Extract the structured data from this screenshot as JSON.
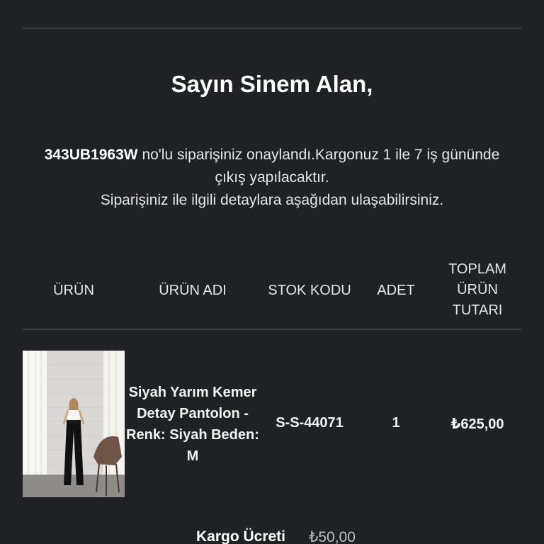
{
  "greeting": "Sayın Sinem Alan,",
  "message": {
    "order_no": "343UB1963W",
    "line1_rest": " no'lu siparişiniz onaylandı.Kargonuz 1 ile 7 iş gününde çıkış yapılacaktır.",
    "line2": "Siparişiniz ile ilgili detaylara aşağıdan ulaşabilirsiniz."
  },
  "table": {
    "headers": {
      "product": "ÜRÜN",
      "product_name": "ÜRÜN ADI",
      "stock_code": "STOK KODU",
      "quantity": "ADET",
      "total": "TOPLAM ÜRÜN TUTARI"
    },
    "row": {
      "name": "Siyah Yarım Kemer Detay Pantolon - Renk: Siyah Beden: M",
      "stock_code": "S-S-44071",
      "quantity": "1",
      "total": "₺625,00"
    }
  },
  "shipping": {
    "label": "Kargo Ücreti",
    "value": "₺50,00"
  }
}
